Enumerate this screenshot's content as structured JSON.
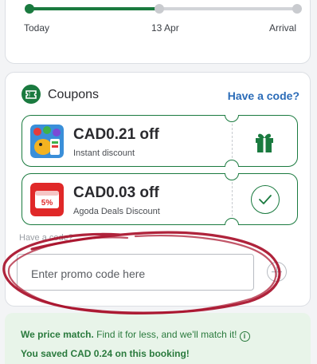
{
  "timeline": {
    "progress": 0.49,
    "labels": [
      "Today",
      "13 Apr",
      "Arrival"
    ]
  },
  "coupons": {
    "title": "Coupons",
    "have_code_link": "Have a code?",
    "items": [
      {
        "amount": "CAD0.21 off",
        "label": "Instant discount",
        "action_icon": "gift-icon"
      },
      {
        "amount": "CAD0.03 off",
        "label": "Agoda Deals Discount",
        "action_icon": "check-icon",
        "logo_text": "5%"
      }
    ],
    "have_code_label": "Have a code?",
    "promo_placeholder": "Enter promo code here"
  },
  "price_match": {
    "headline": "We price match.",
    "body": " Find it for less, and we'll match it!",
    "saved": "You saved CAD 0.24 on this booking!"
  },
  "colors": {
    "accent_green": "#1a7a3f",
    "link_blue": "#2b6cb8",
    "annotation_red": "#a8102a"
  }
}
